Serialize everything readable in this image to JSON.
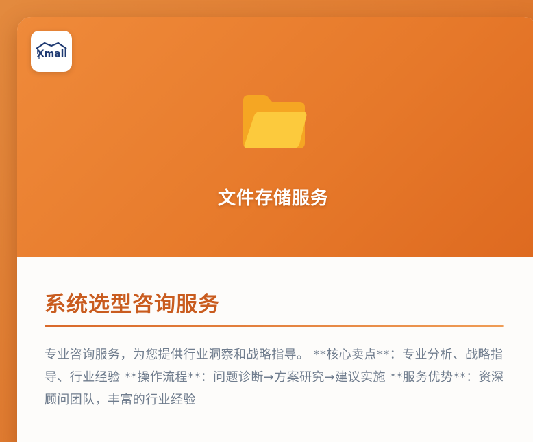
{
  "logo": {
    "text": "Xmall"
  },
  "hero": {
    "icon": "folder-icon",
    "title": "文件存储服务"
  },
  "content": {
    "title": "系统选型咨询服务",
    "description": "专业咨询服务，为您提供行业洞察和战略指导。 **核心卖点**：专业分析、战略指导、行业经验 **操作流程**：问题诊断→方案研究→建议实施 **服务优势**：资深顾问团队，丰富的行业经验"
  },
  "colors": {
    "background": "#e07a2f",
    "hero": "#e77a2b",
    "title_accent": "#c95c1f",
    "description_text": "#6f7c8d",
    "folder_back": "#f5a623",
    "folder_front": "#fcca3d"
  }
}
